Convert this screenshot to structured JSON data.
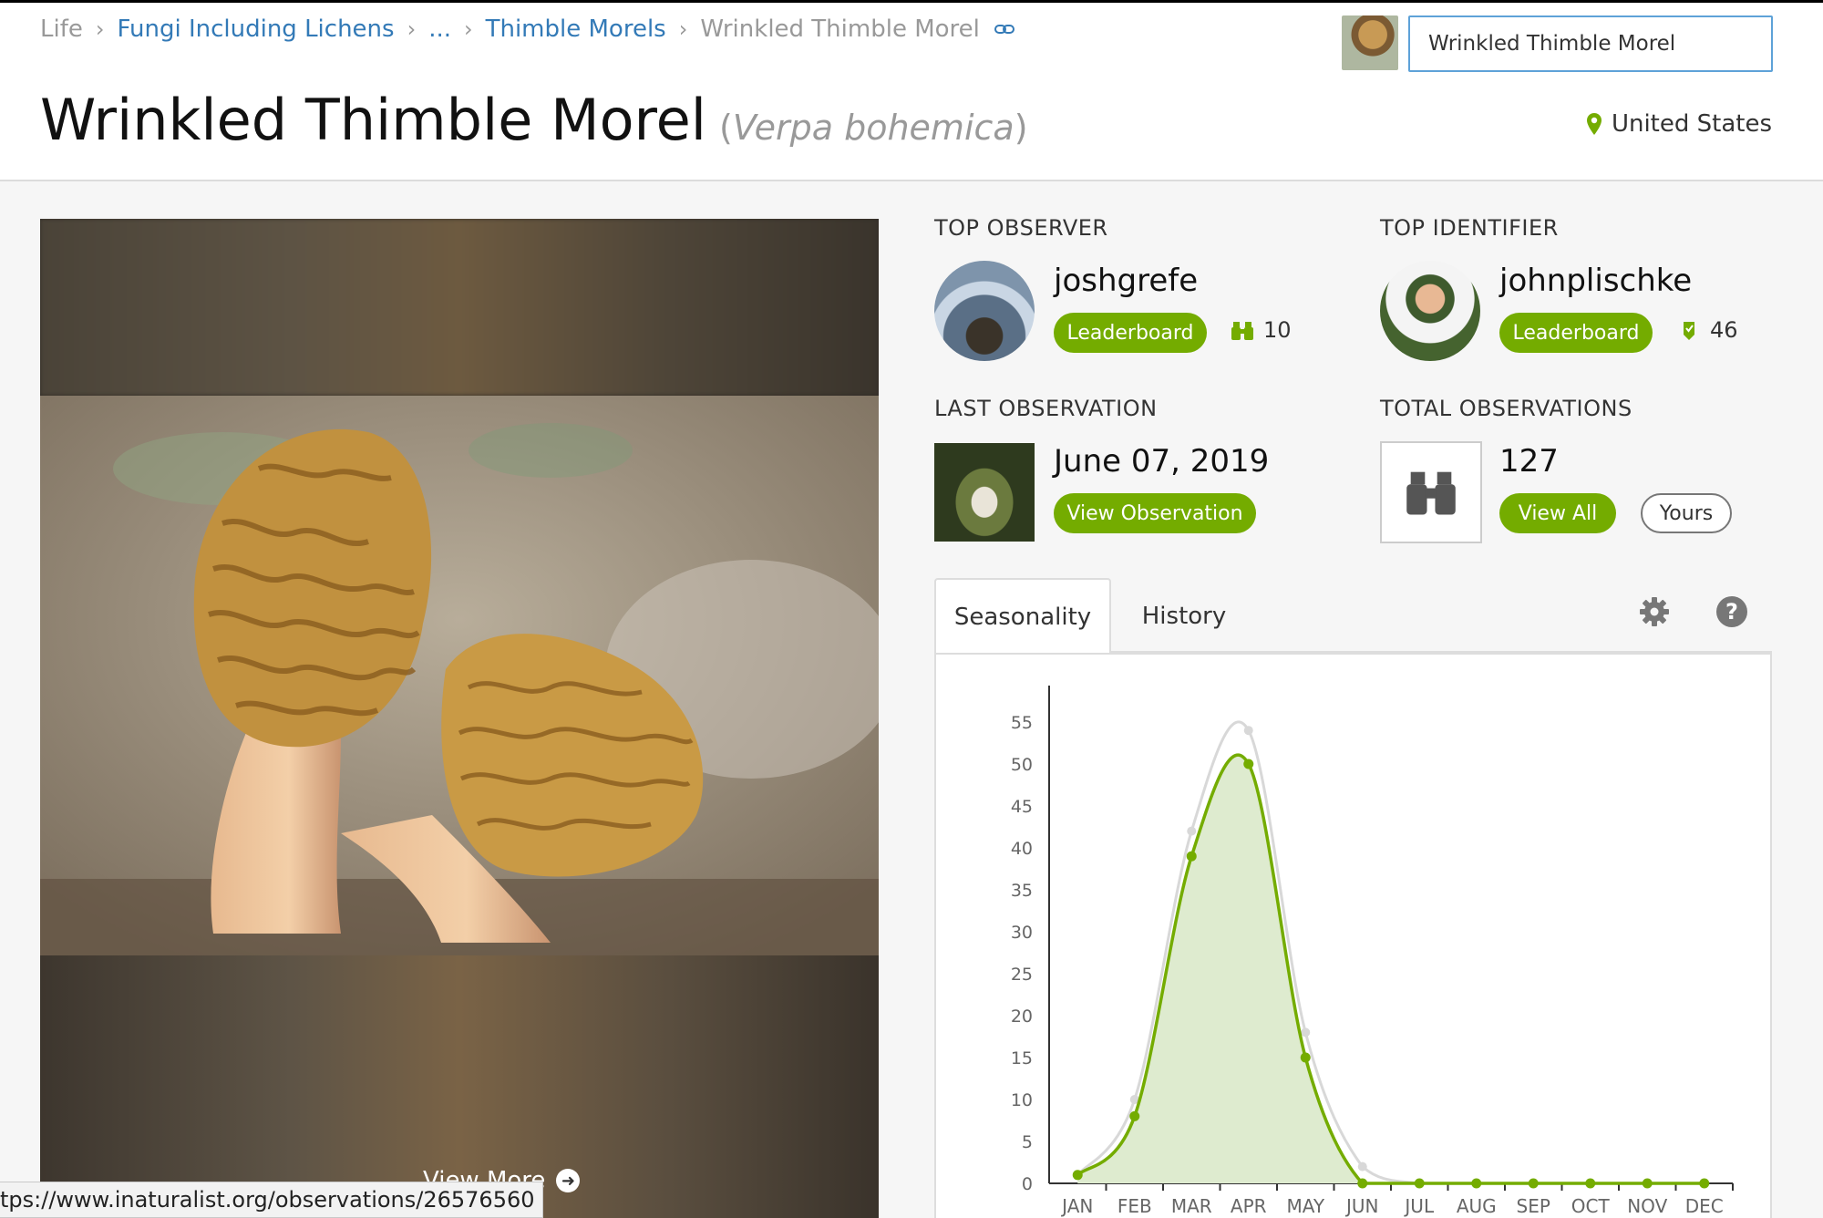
{
  "breadcrumb": {
    "life": "Life",
    "kingdom": "Fungi Including Lichens",
    "ellipsis": "...",
    "genus": "Thimble Morels",
    "current": "Wrinkled Thimble Morel"
  },
  "title": {
    "common_name": "Wrinkled Thimble Morel",
    "sci_open": "(",
    "scientific_name": "Verpa bohemica",
    "sci_close": ")"
  },
  "search": {
    "value": "Wrinkled Thimble Morel"
  },
  "place": {
    "name": "United States",
    "icon": "map-marker-icon"
  },
  "photo": {
    "view_more": "View More"
  },
  "status_bar": {
    "url": "tps://www.inaturalist.org/observations/26576560"
  },
  "top_observer": {
    "label": "TOP OBSERVER",
    "username": "joshgrefe",
    "button": "Leaderboard",
    "count": "10",
    "icon": "binoculars-icon"
  },
  "top_identifier": {
    "label": "TOP IDENTIFIER",
    "username": "johnplischke",
    "button": "Leaderboard",
    "count": "46",
    "icon": "identification-tag-icon"
  },
  "last_observation": {
    "label": "LAST OBSERVATION",
    "date": "June 07, 2019",
    "button": "View Observation"
  },
  "total_observations": {
    "label": "TOTAL OBSERVATIONS",
    "count": "127",
    "view_all": "View All",
    "yours": "Yours"
  },
  "tabs": [
    {
      "label": "Seasonality",
      "active": true
    },
    {
      "label": "History",
      "active": false
    }
  ],
  "colors": {
    "accent": "#74ac00",
    "link": "#337ab7",
    "chart_fill": "#deebcf",
    "chart_gray": "#d8d8d8"
  },
  "chart_data": {
    "type": "area",
    "categories": [
      "JAN",
      "FEB",
      "MAR",
      "APR",
      "MAY",
      "JUN",
      "JUL",
      "AUG",
      "SEP",
      "OCT",
      "NOV",
      "DEC"
    ],
    "ylim": [
      0,
      55
    ],
    "yticks": [
      0,
      5,
      10,
      15,
      20,
      25,
      30,
      35,
      40,
      45,
      50,
      55
    ],
    "series": [
      {
        "values": [
          1,
          8,
          39,
          50,
          15,
          0,
          0,
          0,
          0,
          0,
          0,
          0
        ],
        "color": "#74ac00",
        "fill": true
      },
      {
        "values": [
          1,
          10,
          42,
          54,
          18,
          2,
          0,
          0,
          0,
          0,
          0,
          0
        ],
        "color": "#d8d8d8",
        "fill": false
      }
    ],
    "grid": false
  }
}
